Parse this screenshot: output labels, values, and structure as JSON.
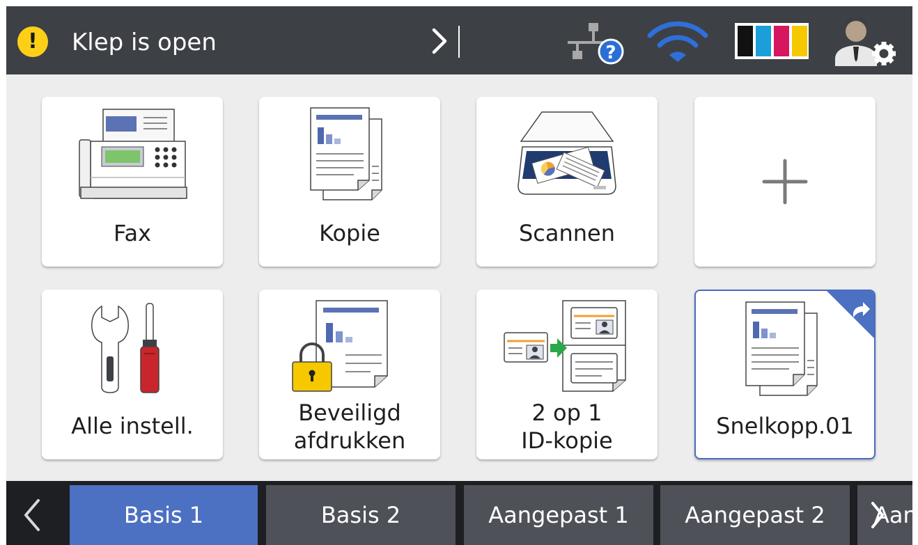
{
  "status_bar": {
    "message": "Klep is open",
    "warning_color": "#fdd017",
    "icons": [
      "warning-icon",
      "more-arrow-icon",
      "network-help-icon",
      "wifi-icon",
      "ink-levels-icon",
      "admin-settings-icon"
    ],
    "ink_colors": [
      "#111111",
      "#1c9fd8",
      "#d6175f",
      "#f5c800"
    ]
  },
  "tiles": [
    {
      "label": "Fax",
      "icon": "fax-machine-icon"
    },
    {
      "label": "Kopie",
      "icon": "copy-documents-icon"
    },
    {
      "label": "Scannen",
      "icon": "scanner-icon"
    },
    {
      "label": "",
      "icon": "plus-icon"
    },
    {
      "label": "Alle instell.",
      "icon": "tools-icon"
    },
    {
      "line1": "Beveiligd",
      "line2": "afdrukken",
      "icon": "secure-print-icon"
    },
    {
      "line1": "2 op 1",
      "line2": "ID-kopie",
      "icon": "id-copy-icon"
    },
    {
      "label": "Snelkopp.01",
      "icon": "shortcut-copy-icon",
      "selected": true
    }
  ],
  "tabs": [
    {
      "label": "Basis 1",
      "active": true
    },
    {
      "label": "Basis 2",
      "active": false
    },
    {
      "label": "Aangepast 1",
      "active": false
    },
    {
      "label": "Aangepast 2",
      "active": false
    }
  ],
  "tab_next_peek": "Aan",
  "accent_color": "#4c70c2"
}
